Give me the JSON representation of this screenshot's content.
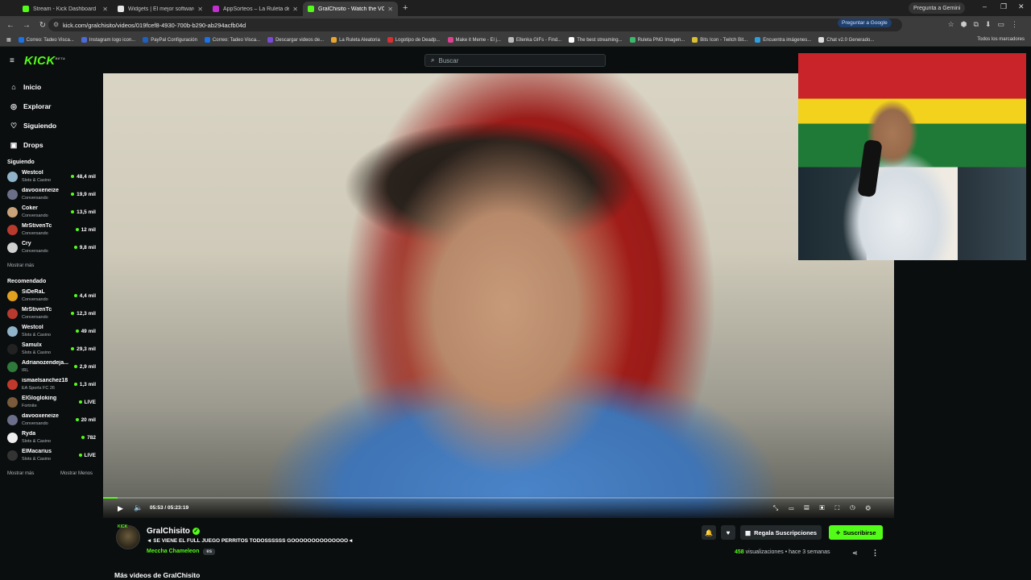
{
  "browser": {
    "tabs": [
      {
        "title": "Stream - Kick Dashboard",
        "color": "#53fc18"
      },
      {
        "title": "Widgets | El mejor software pa",
        "color": "#e6e6e6"
      },
      {
        "title": "AppSorteos – La Ruleta de la S",
        "color": "#c32fd0"
      },
      {
        "title": "GralChisito - Watch the VOD o",
        "color": "#53fc18"
      }
    ],
    "new_tab": "+",
    "gemini": "Pregunta a Gemini",
    "url": "kick.com/gralchisito/videos/019fcef8-4930-700b-b290-ab294acfb04d",
    "ask_google": "Preguntar a Google",
    "bookmarks": [
      {
        "label": "Correo: Tadeo Visca...",
        "color": "#1a73e8"
      },
      {
        "label": "Instagram logo icon...",
        "color": "#4b6bd8"
      },
      {
        "label": "PayPal Configuración",
        "color": "#1f5fbf"
      },
      {
        "label": "Correo: Tadeo Visca...",
        "color": "#1a73e8"
      },
      {
        "label": "Descargar videos de...",
        "color": "#7a4ad8"
      },
      {
        "label": "La Ruleta Aleatoria",
        "color": "#e8a530"
      },
      {
        "label": "Logotipo de Deadp...",
        "color": "#d83030"
      },
      {
        "label": "Make it Meme - El j...",
        "color": "#e04090"
      },
      {
        "label": "Ellenka GIFs - Find...",
        "color": "#bbbbbb"
      },
      {
        "label": "The best streaming...",
        "color": "#ffffff"
      },
      {
        "label": "Ruleta PNG Imagen...",
        "color": "#3ab86b"
      },
      {
        "label": "Bits Icon - Twitch Bit...",
        "color": "#d8c030"
      },
      {
        "label": "Encuentra imágenes...",
        "color": "#2c9fe0"
      },
      {
        "label": "Chat v2.0 Generado...",
        "color": "#dddddd"
      }
    ],
    "all_bookmarks": "Todos los marcadores"
  },
  "kick": {
    "logo": "KICK",
    "logo_badge": "BETA",
    "search_placeholder": "Buscar",
    "nav": [
      {
        "label": "Inicio",
        "icon": "home-icon",
        "glyph": "⌂"
      },
      {
        "label": "Explorar",
        "icon": "compass-icon",
        "glyph": "◎"
      },
      {
        "label": "Siguiendo",
        "icon": "heart-icon",
        "glyph": "♡"
      },
      {
        "label": "Drops",
        "icon": "gift-icon",
        "glyph": "▣"
      }
    ],
    "following_title": "Siguiendo",
    "following": [
      {
        "name": "Westcol",
        "category": "Slots & Casino",
        "viewers": "48,4 mil",
        "color": "#8fb3c9"
      },
      {
        "name": "davooxeneize",
        "category": "Conversando",
        "viewers": "19,9 mil",
        "color": "#6c6f8a"
      },
      {
        "name": "Coker",
        "category": "Conversando",
        "viewers": "13,5 mil",
        "color": "#c9a27a"
      },
      {
        "name": "MrStivenTc",
        "category": "Conversando",
        "viewers": "12 mil",
        "color": "#b83a2f"
      },
      {
        "name": "Cry",
        "category": "Conversando",
        "viewers": "9,8 mil",
        "color": "#d0d0d0"
      }
    ],
    "show_more": "Mostrar más",
    "recommended_title": "Recomendado",
    "recommended": [
      {
        "name": "SiDeRaL",
        "category": "Conversando",
        "viewers": "4,4 mil",
        "color": "#e0a020"
      },
      {
        "name": "MrStivenTc",
        "category": "Conversando",
        "viewers": "12,3 mil",
        "color": "#b83a2f"
      },
      {
        "name": "Westcol",
        "category": "Slots & Casino",
        "viewers": "49 mil",
        "color": "#8fb3c9"
      },
      {
        "name": "Samulx",
        "category": "Slots & Casino",
        "viewers": "29,3 mil",
        "color": "#222222"
      },
      {
        "name": "Adrianozendeja...",
        "category": "IRL",
        "viewers": "2,9 mil",
        "color": "#2f7a3a"
      },
      {
        "name": "ismaelsanchez18",
        "category": "EA Sports FC 26",
        "viewers": "1,3 mil",
        "color": "#c0392b"
      },
      {
        "name": "ElGlogloking",
        "category": "Fortnite",
        "viewers": "LIVE",
        "color": "#7a5a3a"
      },
      {
        "name": "davooxeneize",
        "category": "Conversando",
        "viewers": "20 mil",
        "color": "#6c6f8a"
      },
      {
        "name": "Ryda",
        "category": "Slots & Casino",
        "viewers": "782",
        "color": "#eeeeee"
      },
      {
        "name": "ElMacarius",
        "category": "Slots & Casino",
        "viewers": "LIVE",
        "color": "#333333"
      }
    ],
    "show_more_2": "Mostrar más",
    "show_less": "Mostrar Menos",
    "player": {
      "time": "05:53 / 05:23:19",
      "progress": 0.018
    },
    "channel": {
      "name": "GralChisito",
      "avatar_badge": "KICK",
      "verified_glyph": "✓",
      "title": "◄ SE VIENE EL FULL JUEGO PERRITOS TODOSSSSSS GOOOOOOOOOOOOOO◄",
      "category": "Meccha Chameleon",
      "language": "es",
      "gift_label": "Regala Suscripciones",
      "subscribe_label": "Suscribirse",
      "views": "458",
      "views_label": "visualizaciones",
      "separator": "•",
      "time_ago": "hace 3 semanas"
    },
    "more_videos": "Más videos de GralChisito"
  }
}
